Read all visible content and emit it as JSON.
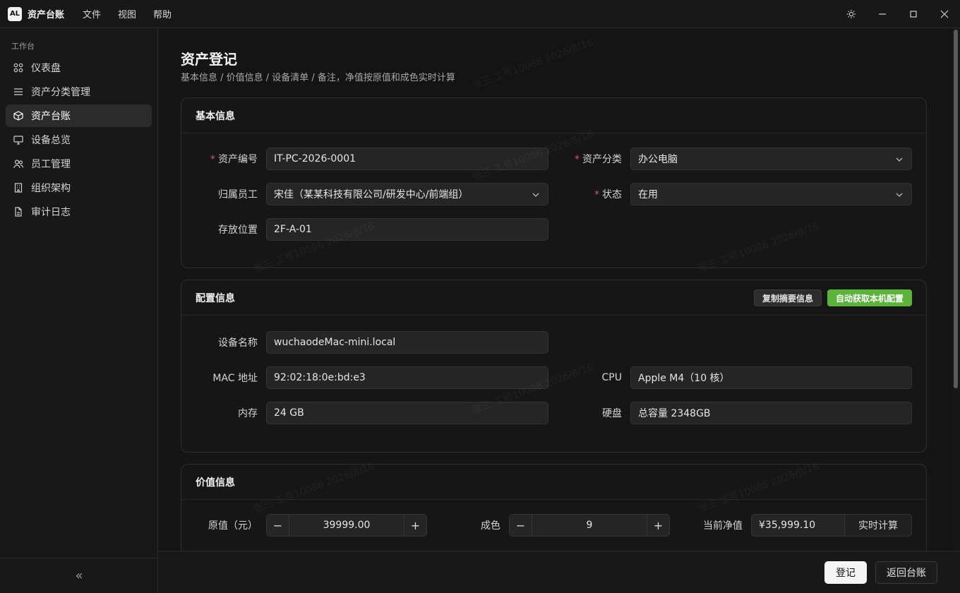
{
  "app": {
    "logo": "AL",
    "title": "资产台账"
  },
  "menu": [
    "文件",
    "视图",
    "帮助"
  ],
  "sidebar": {
    "section": "工作台",
    "items": [
      {
        "label": "仪表盘",
        "icon": "grid-icon"
      },
      {
        "label": "资产分类管理",
        "icon": "list-icon"
      },
      {
        "label": "资产台账",
        "icon": "box-icon",
        "active": true
      },
      {
        "label": "设备总览",
        "icon": "monitor-icon"
      },
      {
        "label": "员工管理",
        "icon": "users-icon"
      },
      {
        "label": "组织架构",
        "icon": "building-icon"
      },
      {
        "label": "审计日志",
        "icon": "file-icon"
      }
    ],
    "collapse": "«"
  },
  "page": {
    "title": "资产登记",
    "subtitle": "基本信息 / 价值信息 / 设备清单 / 备注，净值按原值和成色实时计算"
  },
  "basic": {
    "title": "基本信息",
    "asset_no_label": "资产编号",
    "asset_no": "IT-PC-2026-0001",
    "category_label": "资产分类",
    "category": "办公电脑",
    "owner_label": "归属员工",
    "owner": "宋佳（某某科技有限公司/研发中心/前端组）",
    "status_label": "状态",
    "status": "在用",
    "location_label": "存放位置",
    "location": "2F-A-01"
  },
  "config": {
    "title": "配置信息",
    "copy_btn": "复制摘要信息",
    "auto_btn": "自动获取本机配置",
    "device_label": "设备名称",
    "device": "wuchaodeMac-mini.local",
    "mac_label": "MAC 地址",
    "mac": "92:02:18:0e:bd:e3",
    "cpu_label": "CPU",
    "cpu": "Apple M4（10 核）",
    "mem_label": "内存",
    "mem": "24 GB",
    "disk_label": "硬盘",
    "disk": "总容量 2348GB"
  },
  "value": {
    "title": "价值信息",
    "orig_label": "原值（元）",
    "orig": "39999.00",
    "cond_label": "成色",
    "cond": "9",
    "net_label": "当前净值",
    "net": "¥35,999.10",
    "calc_btn": "实时计算",
    "minus": "−",
    "plus": "+"
  },
  "footer": {
    "submit": "登记",
    "back": "返回台账"
  },
  "watermark": "张三 工号10086 2026/8/16",
  "colors": {
    "accent_green": "#5ab43a",
    "required": "#e5534b",
    "bg": "#141414"
  }
}
